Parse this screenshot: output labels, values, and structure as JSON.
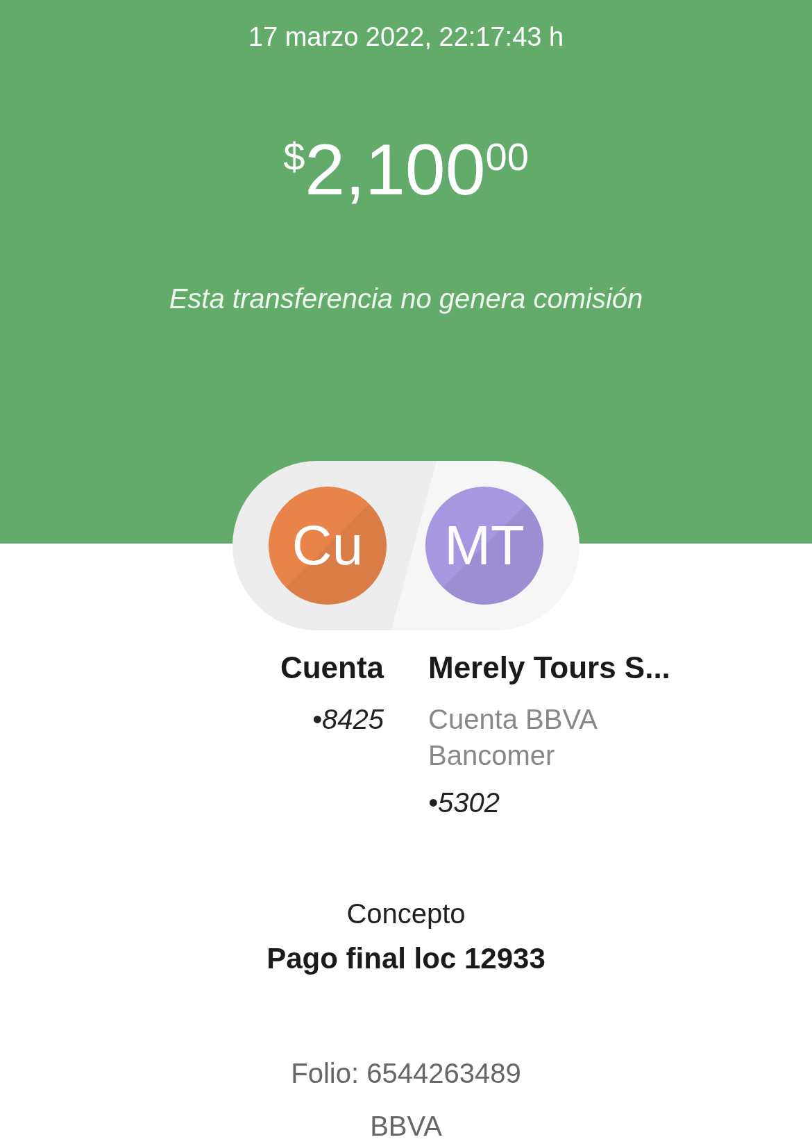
{
  "datetime": "17 marzo 2022, 22:17:43 h",
  "amount": {
    "currency": "$",
    "whole": "2,100",
    "cents": "00"
  },
  "note": "Esta transferencia no genera comisión",
  "parties": [
    {
      "initials": "Cu",
      "color": "#e8844a",
      "name": "Cuenta",
      "account": "•8425"
    },
    {
      "initials": "MT",
      "color": "#a796e0",
      "name": "Merely Tours S...",
      "detail": "Cuenta BBVA Bancomer",
      "account": "•5302"
    }
  ],
  "concept": {
    "label": "Concepto",
    "value": "Pago final loc 12933"
  },
  "folio": "Folio: 6544263489",
  "bank": "BBVA"
}
